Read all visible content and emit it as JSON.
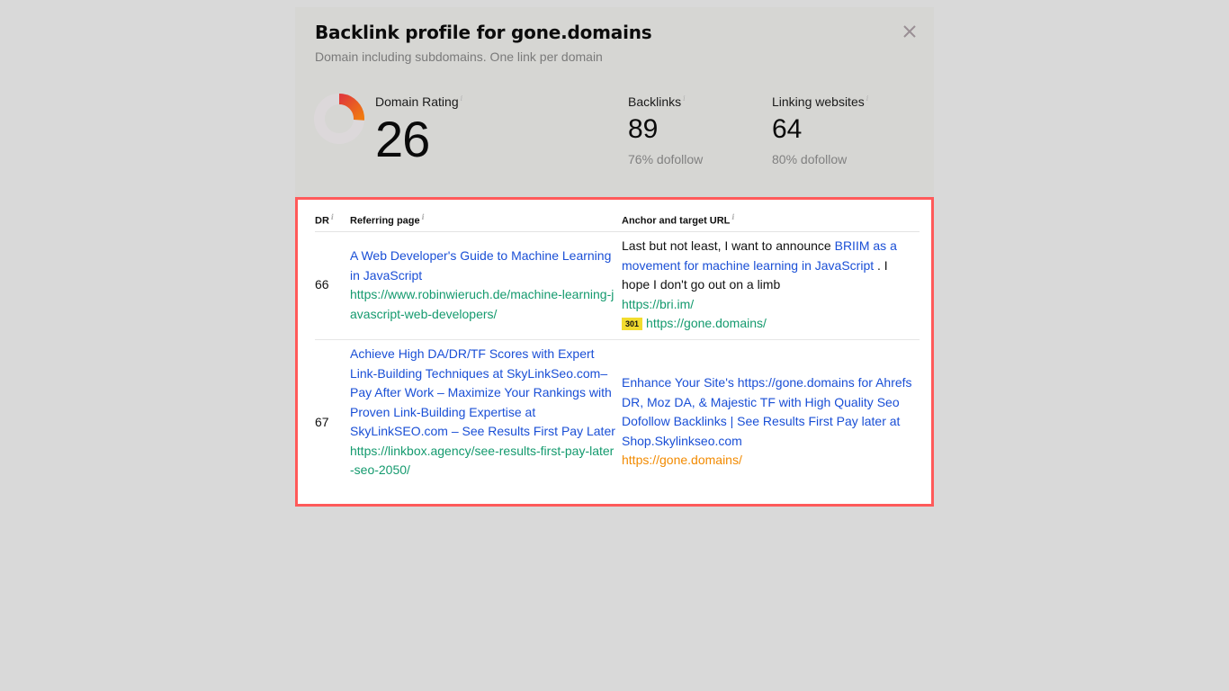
{
  "modal": {
    "title": "Backlink profile for gone.domains",
    "subtitle": "Domain including subdomains. One link per domain",
    "close_icon": "close-icon"
  },
  "metrics": {
    "domain_rating": {
      "label": "Domain Rating",
      "info_icon": "i",
      "value": "26",
      "gauge_fraction": 0.26,
      "gauge_colors": {
        "start": "#e03a3a",
        "end": "#f07a10",
        "track": "#dcd8da"
      }
    },
    "backlinks": {
      "label": "Backlinks",
      "info_icon": "i",
      "value": "89",
      "sub": "76% dofollow"
    },
    "linking_websites": {
      "label": "Linking websites",
      "info_icon": "i",
      "value": "64",
      "sub": "80% dofollow"
    }
  },
  "table": {
    "highlight_color": "#ff5a5a",
    "headers": {
      "dr": "DR",
      "referring_page": "Referring page",
      "anchor": "Anchor and target URL",
      "info_icon": "i"
    },
    "rows": [
      {
        "dr": "66",
        "ref_title": "A Web Developer's Guide to Machine Learning in JavaScript",
        "ref_url": "https://www.robinwieruch.de/machine-learning-javascript-web-developers/",
        "anchor_before": "Last but not least, I want to announce ",
        "anchor_link": "BRIIM as a movement for machine learning in JavaScript",
        "anchor_after": " . I hope I don't go out on a limb",
        "link_url": "https://bri.im/",
        "redirect_code": "301",
        "target_url": "https://gone.domains/"
      },
      {
        "dr": "67",
        "ref_title": "Achieve High DA/DR/TF Scores with Expert Link-Building Techniques at SkyLinkSeo.com– Pay After Work – Maximize Your Rankings with Proven Link-Building Expertise at SkyLinkSEO.com – See Results First Pay Later",
        "ref_url": "https://linkbox.agency/see-results-first-pay-later-seo-2050/",
        "anchor_link": "Enhance Your Site's https://gone.domains for Ahrefs DR, Moz DA, & Majestic TF with High Quality Seo Dofollow Backlinks | See Results First Pay later at Shop.Skylinkseo.com",
        "target_url": "https://gone.domains/"
      }
    ]
  }
}
